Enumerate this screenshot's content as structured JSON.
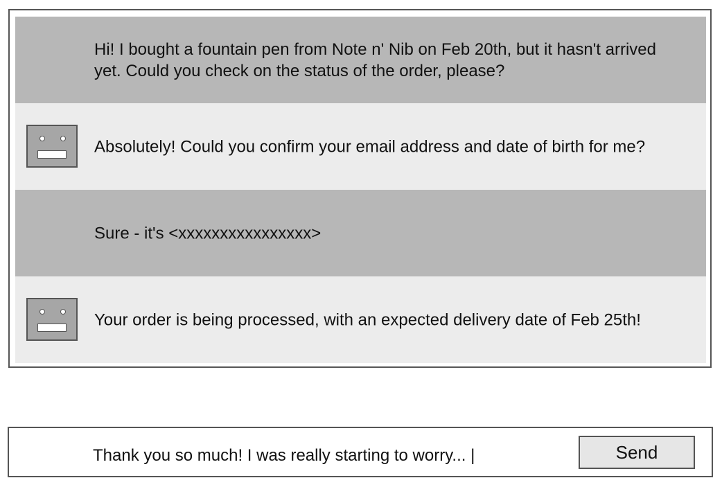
{
  "messages": [
    {
      "sender": "user",
      "text": "Hi! I bought a fountain pen from Note n' Nib on Feb 20th, but it hasn't arrived yet. Could you check on the status of the order, please?"
    },
    {
      "sender": "bot",
      "text": "Absolutely! Could you confirm your email address and date of birth for me?"
    },
    {
      "sender": "user",
      "text": "Sure - it's <xxxxxxxxxxxxxxxx>"
    },
    {
      "sender": "bot",
      "text": "Your order is being processed, with an expected delivery date of Feb 25th!"
    }
  ],
  "composer": {
    "input_value": "Thank you so much! I was really starting to worry... |",
    "send_label": "Send"
  },
  "colors": {
    "user_bubble": "#b7b7b7",
    "bot_bubble": "#ececec",
    "border": "#555555",
    "avatar": "#a6a6a6"
  },
  "icons": {
    "bot_avatar": "robot-face-icon"
  }
}
